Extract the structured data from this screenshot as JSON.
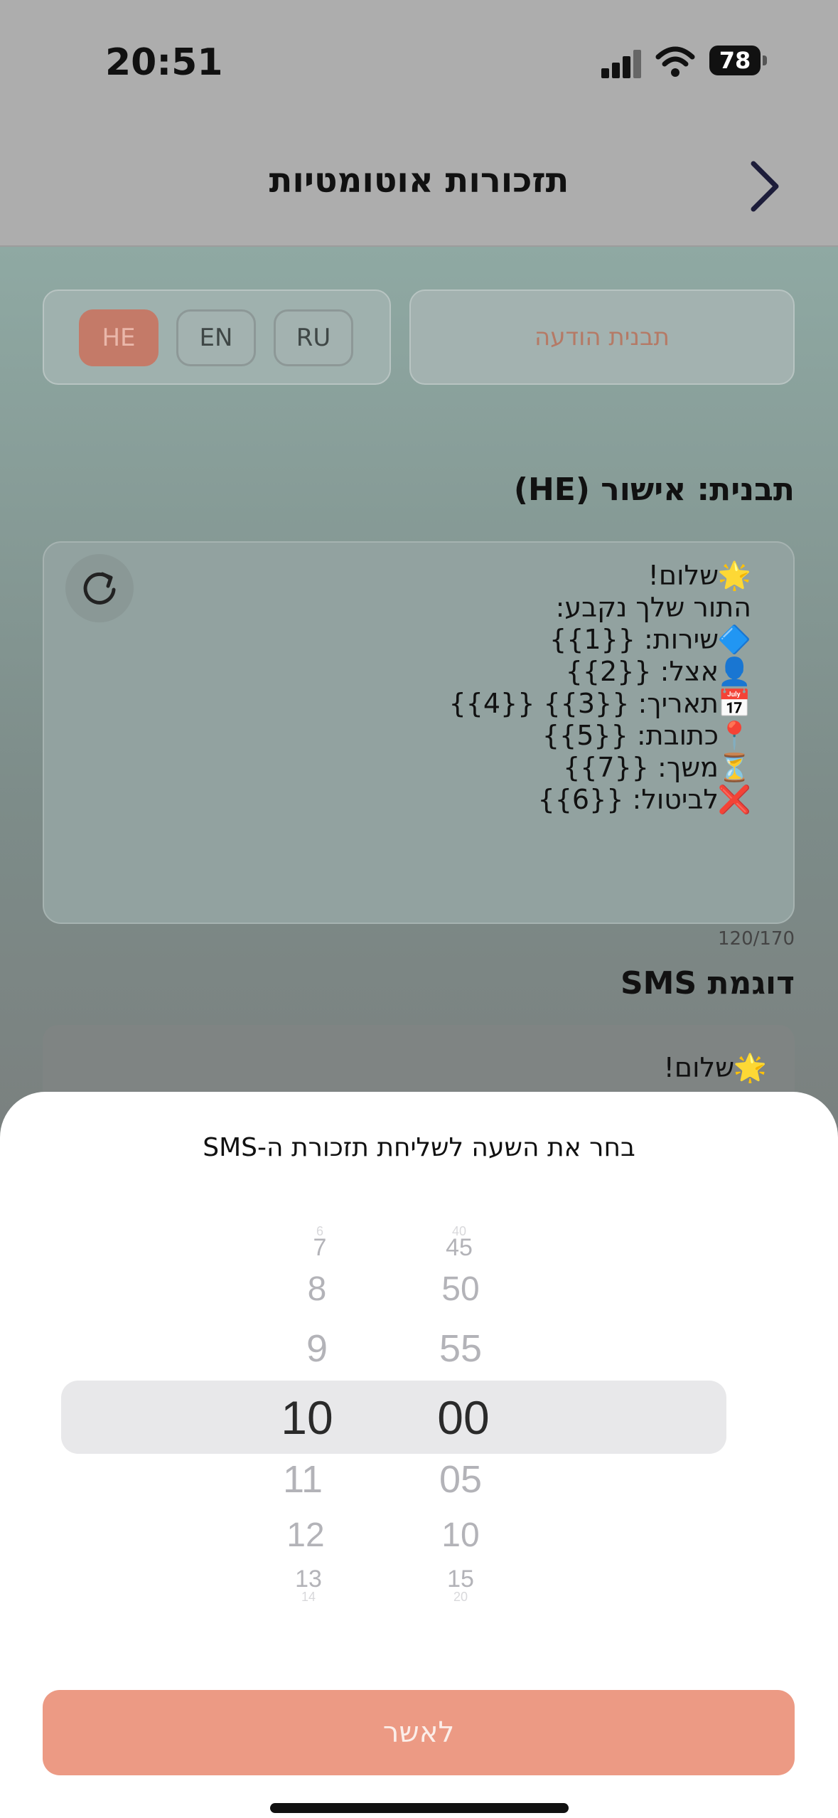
{
  "status_bar": {
    "time": "20:51",
    "battery": "78"
  },
  "header": {
    "title": "תזכורות אוטומטיות"
  },
  "languages": [
    {
      "code": "HE",
      "active": true
    },
    {
      "code": "EN",
      "active": false
    },
    {
      "code": "RU",
      "active": false
    }
  ],
  "template_button_label": "תבנית הודעה",
  "template_section_title": "תבנית: אישור (HE)",
  "message_lines": [
    {
      "icon": "🌟",
      "text": "שלום!"
    },
    {
      "icon": "",
      "text": "התור שלך נקבע:"
    },
    {
      "icon": "🔷",
      "text": "שירות: {{1}}"
    },
    {
      "icon": "👤",
      "text": "אצל: {{2}}"
    },
    {
      "icon": "📅",
      "text": "תאריך: {{3}} {{4}}"
    },
    {
      "icon": "📍",
      "text": "כתובת: {{5}}"
    },
    {
      "icon": "⏳",
      "text": "משך: {{7}}"
    },
    {
      "icon": "❌",
      "text": "לביטול: {{6}}"
    }
  ],
  "char_counter": "120/170",
  "sms_preview_title": "דוגמת SMS",
  "sms_preview_first_line": "שלום!",
  "sms_preview_icon": "🌟",
  "sheet": {
    "title": "בחר את השעה לשליחת תזכורת ה-SMS",
    "hours": [
      "6",
      "7",
      "8",
      "9",
      "10",
      "11",
      "12",
      "13",
      "14"
    ],
    "minutes": [
      "40",
      "45",
      "50",
      "55",
      "00",
      "05",
      "10",
      "15",
      "20"
    ],
    "selected_hour": "10",
    "selected_minute": "00",
    "confirm_label": "לאשר"
  },
  "icons": {
    "back": "chevron-right-icon",
    "refresh": "refresh-icon"
  }
}
